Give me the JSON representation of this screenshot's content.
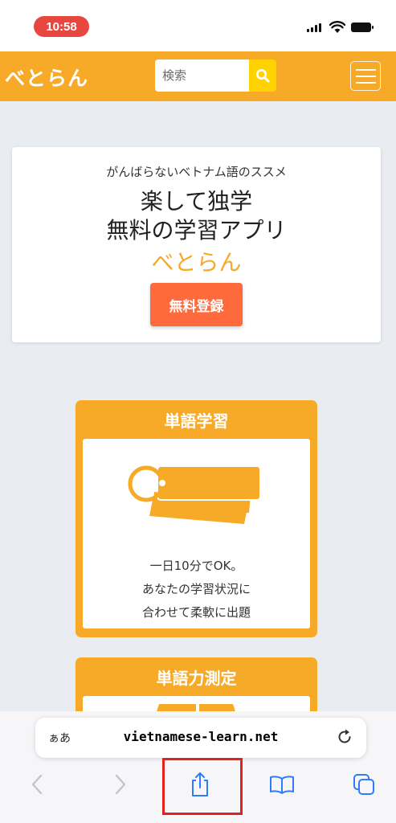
{
  "status": {
    "time": "10:58"
  },
  "header": {
    "logo": "べとらん",
    "search_placeholder": "検索"
  },
  "hero": {
    "subtitle": "がんばらないベトナム語のススメ",
    "title_line1": "楽して独学",
    "title_line2": "無料の学習アプリ",
    "brand": "べとらん",
    "register_label": "無料登録"
  },
  "features": [
    {
      "title": "単語学習",
      "desc_lines": [
        "一日10分でOK。",
        "あなたの学習状況に",
        "合わせて柔軟に出題"
      ]
    },
    {
      "title": "単語力測定"
    }
  ],
  "browser": {
    "aa_label": "ぁあ",
    "url": "vietnamese-learn.net"
  },
  "colors": {
    "brand": "#f7a928",
    "cta": "#ff6a3d",
    "search_button": "#ffd200",
    "safari_blue": "#2f7cf6",
    "highlight": "#e0211d"
  }
}
